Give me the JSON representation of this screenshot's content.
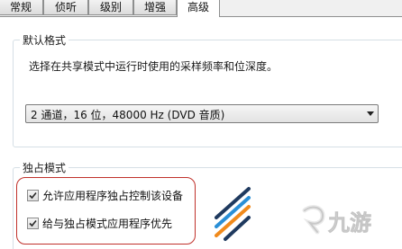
{
  "tabs": [
    {
      "label": "常规"
    },
    {
      "label": "侦听"
    },
    {
      "label": "级别"
    },
    {
      "label": "增强"
    },
    {
      "label": "高级"
    }
  ],
  "active_tab": "高级",
  "default_format": {
    "title": "默认格式",
    "description": "选择在共享模式中运行时使用的采样频率和位深度。",
    "selected_value": "2 通道，16 位，48000 Hz (DVD 音质)"
  },
  "exclusive_mode": {
    "title": "独占模式",
    "options": [
      {
        "label": "允许应用程序独占控制该设备",
        "checked": true
      },
      {
        "label": "给与独占模式应用程序优先",
        "checked": true
      }
    ]
  },
  "annotation": {
    "color": "#c0312b"
  },
  "watermark": {
    "text": "九游",
    "icon": "jiuyou-logo-icon",
    "stripe_colors": [
      "#1f3a5f",
      "#2a8fd6",
      "#f08a1c"
    ]
  }
}
